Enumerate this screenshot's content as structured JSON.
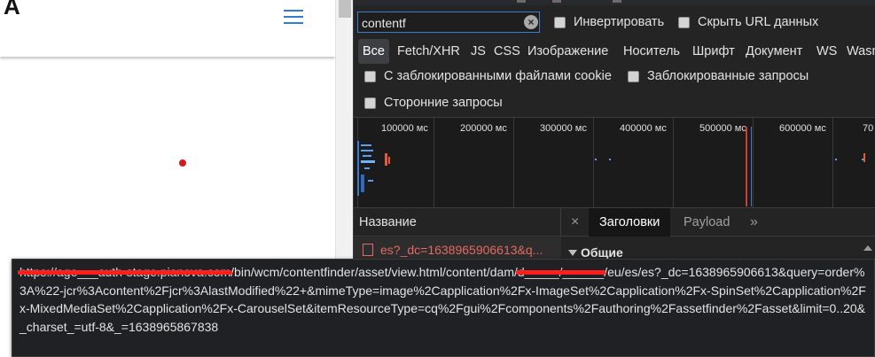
{
  "page": {
    "logo_fragment": "A",
    "menu_icon": "hamburger-icon",
    "accent_color": "#2f7fd0",
    "dot_color": "#d11a1a"
  },
  "devtools": {
    "filter": {
      "value": "contentf",
      "clear_icon": "clear-icon"
    },
    "options": {
      "invert": "Инвертировать",
      "hide_data_urls": "Скрыть URL данных",
      "blocked_cookies": "С заблокированными файлами cookie",
      "blocked_requests": "Заблокированные запросы",
      "third_party": "Сторонние запросы"
    },
    "types": [
      "Все",
      "Fetch/XHR",
      "JS",
      "CSS",
      "Изображение",
      "Носитель",
      "Шрифт",
      "Документ",
      "WS",
      "Wasm"
    ],
    "timeline_ticks": [
      "100000 мс",
      "200000 мс",
      "300000 мс",
      "400000 мс",
      "500000 мс",
      "600000 мс",
      "70"
    ],
    "name_header": "Название",
    "request_name": "es?_dc=1638965906613&q...",
    "tabs": {
      "close": "×",
      "headers": "Заголовки",
      "payload": "Payload",
      "more": "»"
    },
    "section_general": "Общие",
    "error_color": "#e46962"
  },
  "tooltip": {
    "redacted_1": "https://age___auth-stage.pianova.com",
    "part_1": "/bin/wcm/contentfinder/asset/view.html/content/dam/",
    "redacted_2": "d_____/______",
    "part_2": "/eu/es/es?_dc=1638965906613&query=order%3A%22-jcr%3Acontent%2Fjcr%3AlastModified%22+&mimeType=image%2Capplication%2Fx-ImageSet%2Capplication%2Fx-SpinSet%2Capplication%2Fx-MixedMediaSet%2Capplication%2Fx-CarouselSet&itemResourceType=cq%2Fgui%2Fcomponents%2Fauthoring%2Fassetfinder%2Fasset&limit=0..20&_charset_=utf-8&_=1638965867838"
  }
}
